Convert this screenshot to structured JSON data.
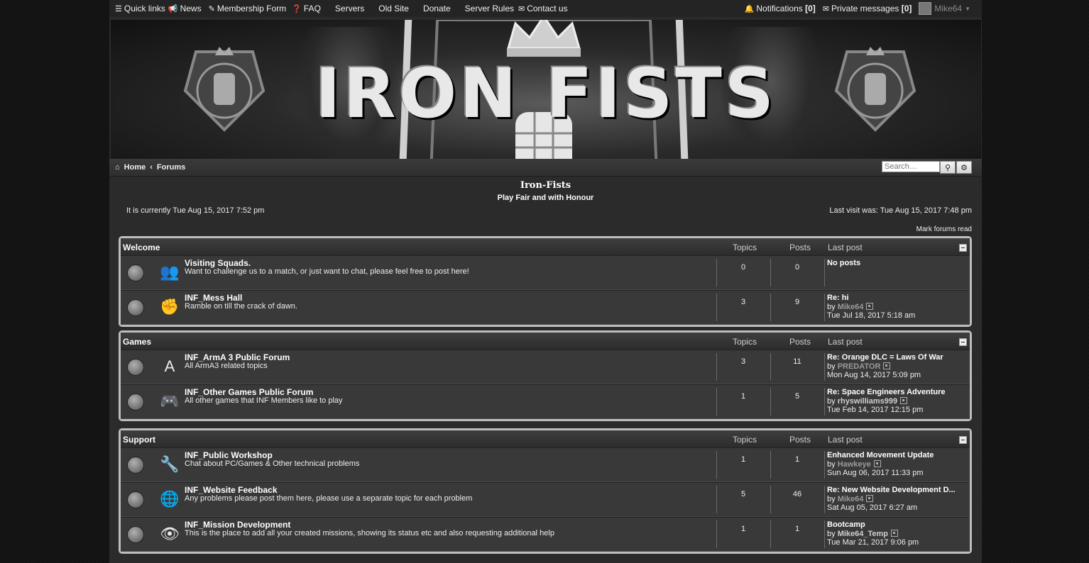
{
  "nav": {
    "quick_links": "Quick links",
    "news": "News",
    "membership": "Membership Form",
    "faq": "FAQ",
    "servers": "Servers",
    "old_site": "Old Site",
    "donate": "Donate",
    "server_rules": "Server Rules",
    "contact": "Contact us",
    "notifications": "Notifications",
    "notifications_count": "[0]",
    "private_messages": "Private messages",
    "pm_count": "[0]",
    "username": "Mike64"
  },
  "banner": {
    "title": "IRON FISTS",
    "emblem_text": "IRONFISTS"
  },
  "breadcrumb": {
    "home": "Home",
    "forums": "Forums"
  },
  "search": {
    "placeholder": "Search…"
  },
  "site": {
    "title": "Iron-Fists",
    "description": "Play Fair and with Honour",
    "current_time": "It is currently Tue Aug 15, 2017 7:52 pm",
    "last_visit": "Last visit was: Tue Aug 15, 2017 7:48 pm",
    "mark_read": "Mark forums read"
  },
  "columns": {
    "topics": "Topics",
    "posts": "Posts",
    "last_post": "Last post"
  },
  "categories": [
    {
      "name": "Welcome",
      "forums": [
        {
          "title": "Visiting Squads.",
          "desc": "Want to challenge us to a match, or just want to chat, please feel free to post here!",
          "topics": "0",
          "posts": "0",
          "last_title": "No posts",
          "last_by_prefix": "",
          "last_user": "",
          "last_time": ""
        },
        {
          "title": "INF_Mess Hall",
          "desc": "Ramble on till the crack of dawn.",
          "topics": "3",
          "posts": "9",
          "last_title": "Re: hi",
          "last_by_prefix": "by",
          "last_user": "Mike64",
          "last_time": "Tue Jul 18, 2017 5:18 am"
        }
      ]
    },
    {
      "name": "Games",
      "forums": [
        {
          "title": "INF_ArmA 3 Public Forum",
          "desc": "All ArmA3 related topics",
          "topics": "3",
          "posts": "11",
          "last_title": "Re: Orange DLC = Laws Of War",
          "last_by_prefix": "by",
          "last_user": "PREDATOR",
          "last_time": "Mon Aug 14, 2017 5:09 pm"
        },
        {
          "title": "INF_Other Games Public Forum",
          "desc": "All other games that INF Members like to play",
          "topics": "1",
          "posts": "5",
          "last_title": "Re: Space Engineers Adventure",
          "last_by_prefix": "by",
          "last_user": "rhyswilliams999",
          "last_time": "Tue Feb 14, 2017 12:15 pm"
        }
      ]
    },
    {
      "name": "Support",
      "forums": [
        {
          "title": "INF_Public Workshop",
          "desc": "Chat about PC/Games & Other technical problems",
          "topics": "1",
          "posts": "1",
          "last_title": "Enhanced Movement Update",
          "last_by_prefix": "by",
          "last_user": "Hawkeye",
          "last_time": "Sun Aug 06, 2017 11:33 pm"
        },
        {
          "title": "INF_Website Feedback",
          "desc": "Any problems please post them here, please use a separate topic for each problem",
          "topics": "5",
          "posts": "46",
          "last_title": "Re: New Website Development D...",
          "last_by_prefix": "by",
          "last_user": "Mike64",
          "last_time": "Sat Aug 05, 2017 6:27 am"
        },
        {
          "title": "INF_Mission Development",
          "desc": "This is the place to add all your created missions, showing its status etc and also requesting additional help",
          "topics": "1",
          "posts": "1",
          "last_title": "Bootcamp",
          "last_by_prefix": "by",
          "last_user": "Mike64_Temp",
          "last_time": "Tue Mar 21, 2017 9:06 pm"
        }
      ]
    }
  ],
  "icons": {
    "welcome_0": "soldiers-icon",
    "welcome_1": "fist-badge-icon",
    "games_0": "arma-logo-icon",
    "games_1": "gamepad-icon",
    "support_0": "tools-icon",
    "support_1": "globe-icon",
    "support_2": "eye-icon"
  }
}
